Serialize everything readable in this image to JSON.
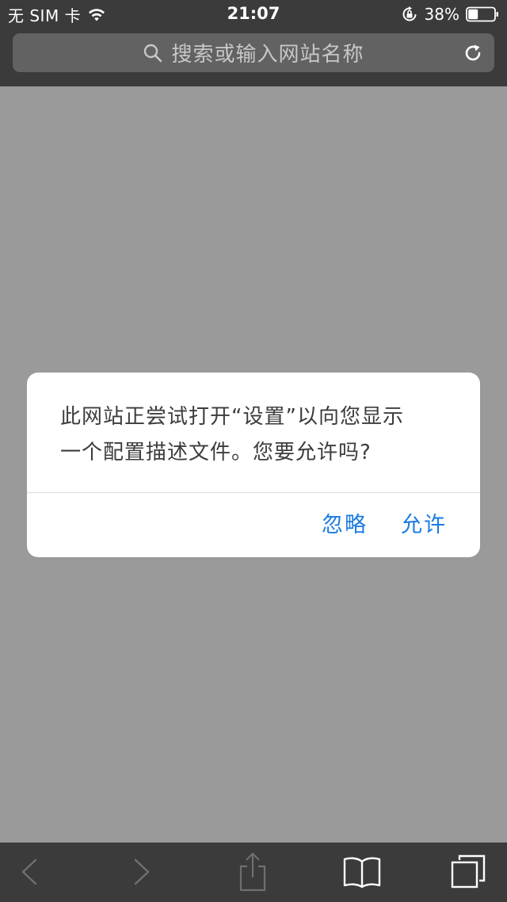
{
  "status_bar": {
    "carrier": "无 SIM 卡",
    "time": "21:07",
    "battery_percent": "38%",
    "battery_level": 0.38,
    "icons": [
      "wifi-icon",
      "orientation-lock-icon",
      "battery-icon"
    ]
  },
  "url_bar": {
    "placeholder": "搜索或输入网站名称",
    "icons": [
      "search-icon",
      "reload-icon"
    ]
  },
  "alert": {
    "message_line1": "此网站正尝试打开“设置”以向您显示",
    "message_line2": "一个配置描述文件。您要允许吗?",
    "ignore_label": "忽略",
    "allow_label": "允许"
  },
  "toolbar": {
    "icons": [
      "back-icon",
      "forward-icon",
      "share-icon",
      "bookmarks-icon",
      "tabs-icon"
    ]
  },
  "colors": {
    "chrome_bg": "#3b3b3b",
    "page_bg": "#9a9a9a",
    "alert_button": "#1a7be0",
    "url_field": "#626262"
  }
}
